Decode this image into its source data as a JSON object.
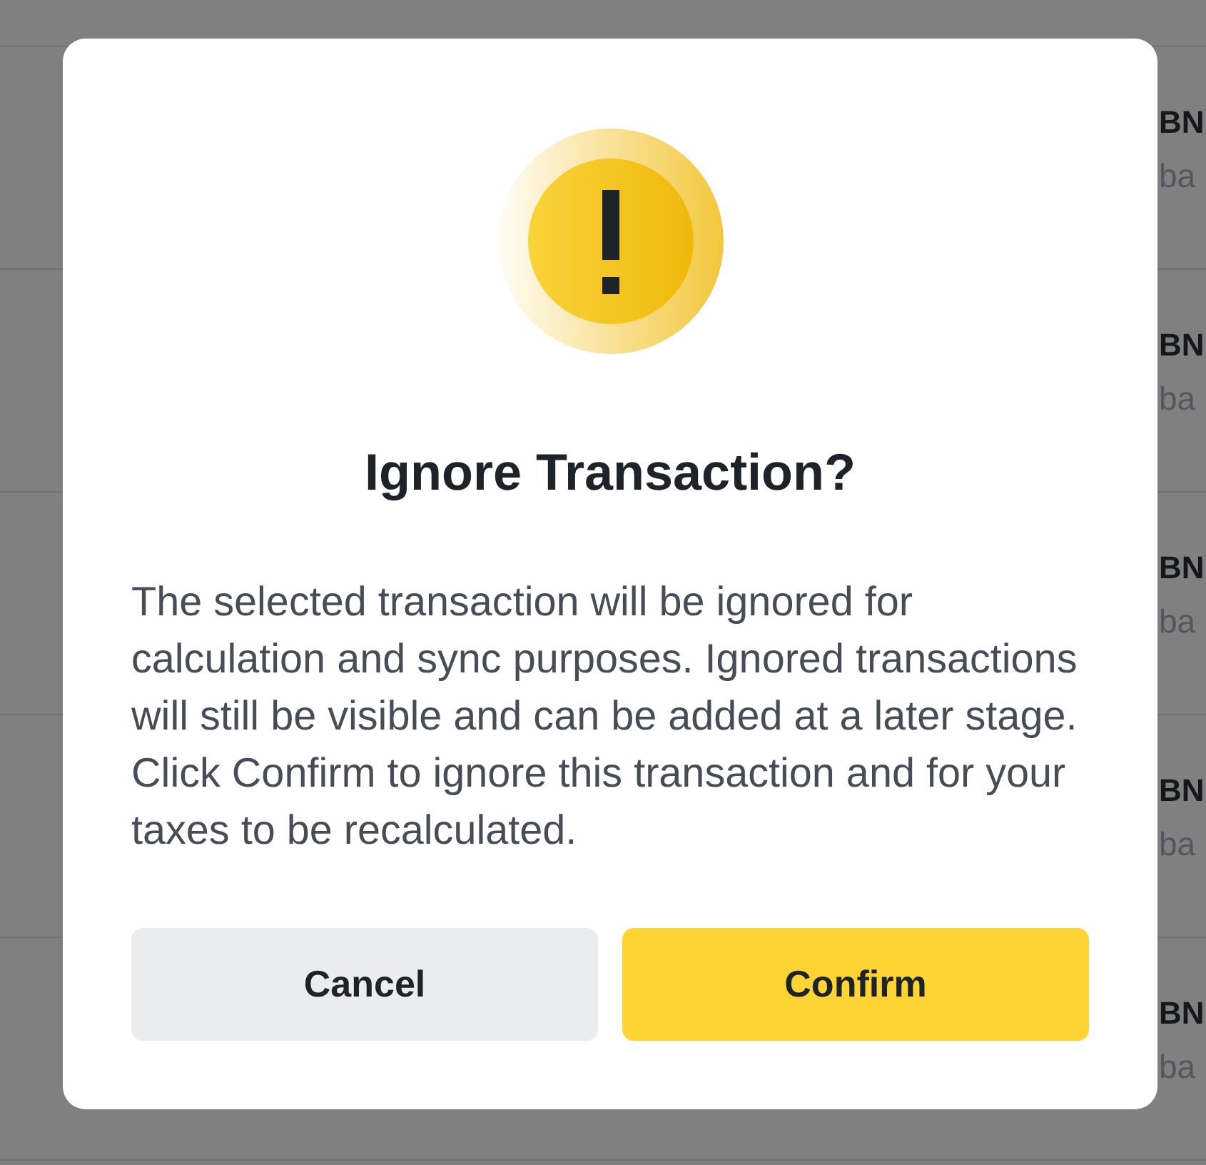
{
  "background_rows": [
    {
      "title": "BN",
      "subtitle": "ba"
    },
    {
      "title": "BN",
      "subtitle": "ba"
    },
    {
      "title": "BN",
      "subtitle": "ba"
    },
    {
      "title": "BN",
      "subtitle": "ba"
    },
    {
      "title": "BN",
      "subtitle": "ba"
    }
  ],
  "dialog": {
    "title": "Ignore Transaction?",
    "message": "The selected transaction will be ignored for calculation and sync purposes. Ignored transactions will still be visible and can be added at a later stage. Click Confirm to ignore this transaction and for your taxes to be recalculated.",
    "buttons": [
      {
        "label": "Cancel",
        "kind": "secondary"
      },
      {
        "label": "Confirm",
        "kind": "primary"
      }
    ]
  }
}
